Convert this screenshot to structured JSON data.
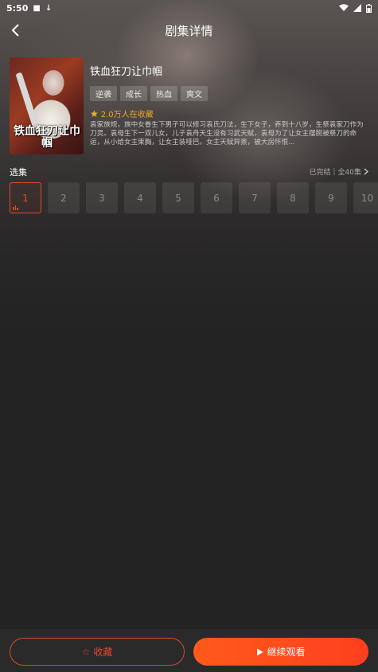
{
  "status_bar": {
    "time": "5:50"
  },
  "header": {
    "title": "剧集详情"
  },
  "drama": {
    "poster_title": "铁血狂刀让巾帼",
    "title": "铁血狂刀让巾帼",
    "tags": [
      "逆袭",
      "成长",
      "热血",
      "爽文"
    ],
    "favorite_text": "2.0万人在收藏",
    "description": "袁家族规，族中女眷生下男子可以修习袁氏刀法，生下女子，养到十八岁，生祭袁家刀作为刀灵。袁母生下一双儿女，儿子袁舟天生没有习武天赋，袁母为了让女主摆脱被祭刀的命运，从小给女主束胸，让女主装哑巴。女主天赋异禀，被大房怀恨..."
  },
  "episodes": {
    "section_title": "选集",
    "status": "已完结",
    "total": "全40集",
    "items": [
      "1",
      "2",
      "3",
      "4",
      "5",
      "6",
      "7",
      "8",
      "9",
      "10"
    ],
    "current_index": 0
  },
  "actions": {
    "collect_label": "收藏",
    "play_label": "继续观看"
  },
  "colors": {
    "accent": "#e24a2c",
    "play_button": "#ff4a1f",
    "favorite": "#f2a52b"
  }
}
